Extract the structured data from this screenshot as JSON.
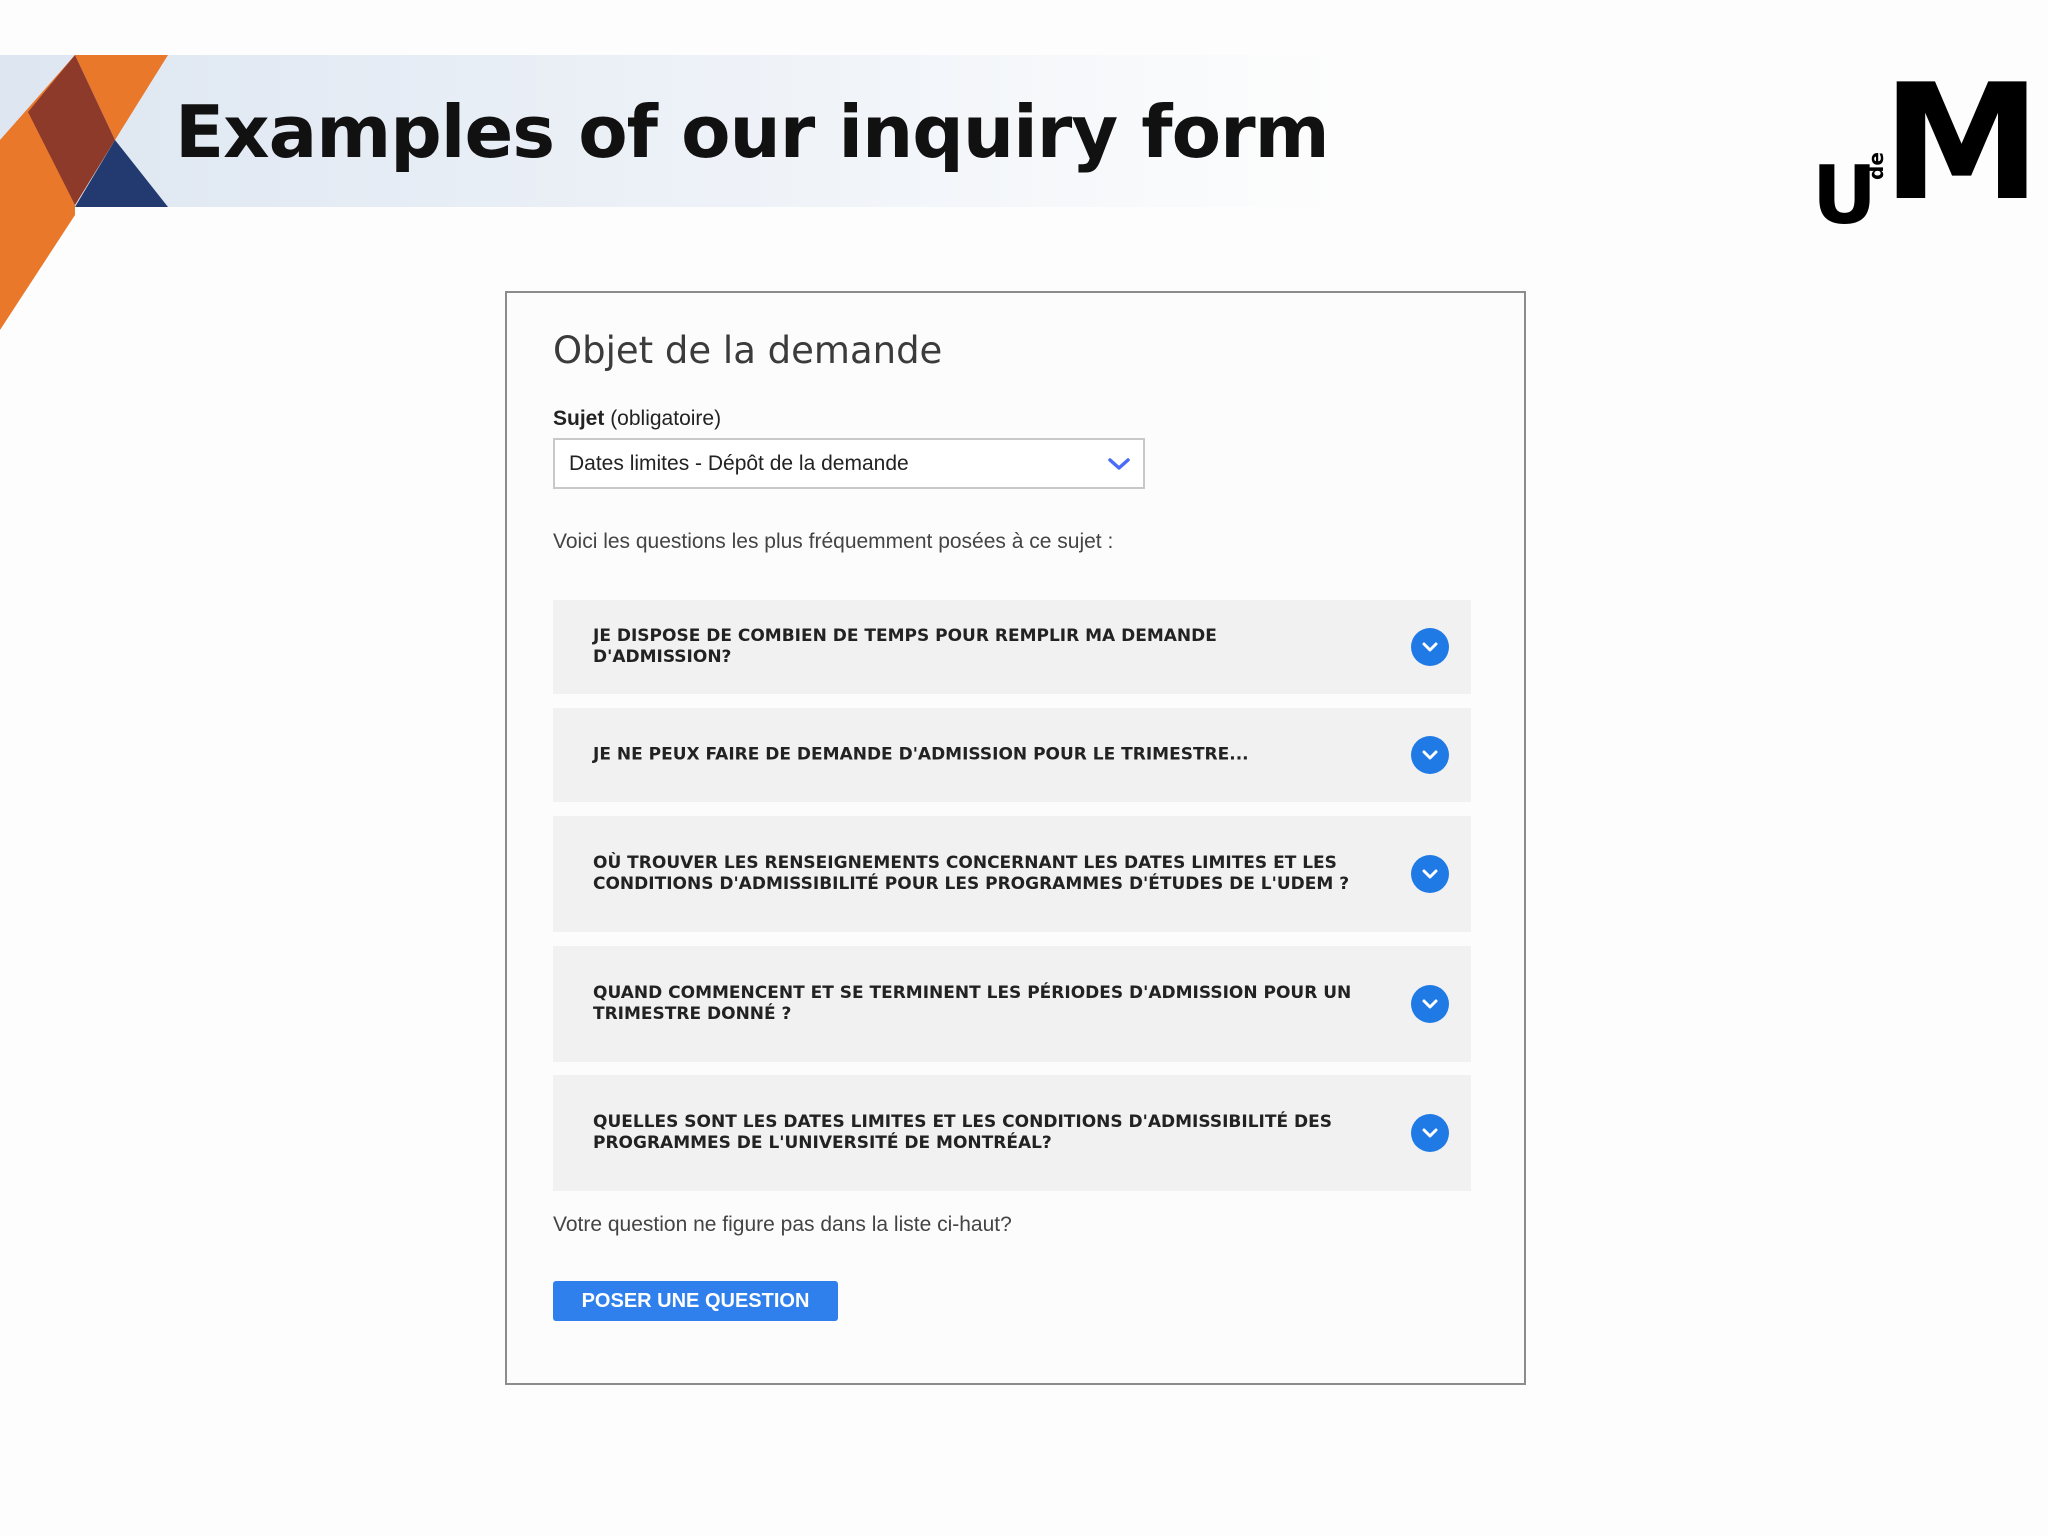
{
  "slide": {
    "title": "Examples of our inquiry form",
    "logo": {
      "u": "U",
      "de": "de",
      "m": "M"
    },
    "accent_colors": {
      "orange": "#e9782b",
      "rust": "#8e3a2b",
      "navy": "#233a70"
    }
  },
  "form": {
    "heading": "Objet de la demande",
    "subject_label": "Sujet",
    "subject_hint": "(obligatoire)",
    "subject_value": "Dates limites - Dépôt de la demande",
    "intro": "Voici les questions les plus fréquemment posées à ce sujet :",
    "faq": [
      {
        "question": "Je dispose de combien de temps pour remplir ma demande d'admission?"
      },
      {
        "question": "Je ne peux faire de demande d'admission pour le trimestre..."
      },
      {
        "question": "Où trouver les renseignements concernant les dates limites et les conditions d'admissibilité pour les programmes d'études de l'UdeM ?"
      },
      {
        "question": "Quand commencent et se terminent les périodes d'admission pour un trimestre donné ?"
      },
      {
        "question": "Quelles sont les dates limites et les conditions d'admissibilité des programmes de l'Université de Montréal?"
      }
    ],
    "no_match": "Votre question ne figure pas dans la liste ci-haut?",
    "ask_button": "Poser une question",
    "accent_color": "#2f80ed"
  }
}
